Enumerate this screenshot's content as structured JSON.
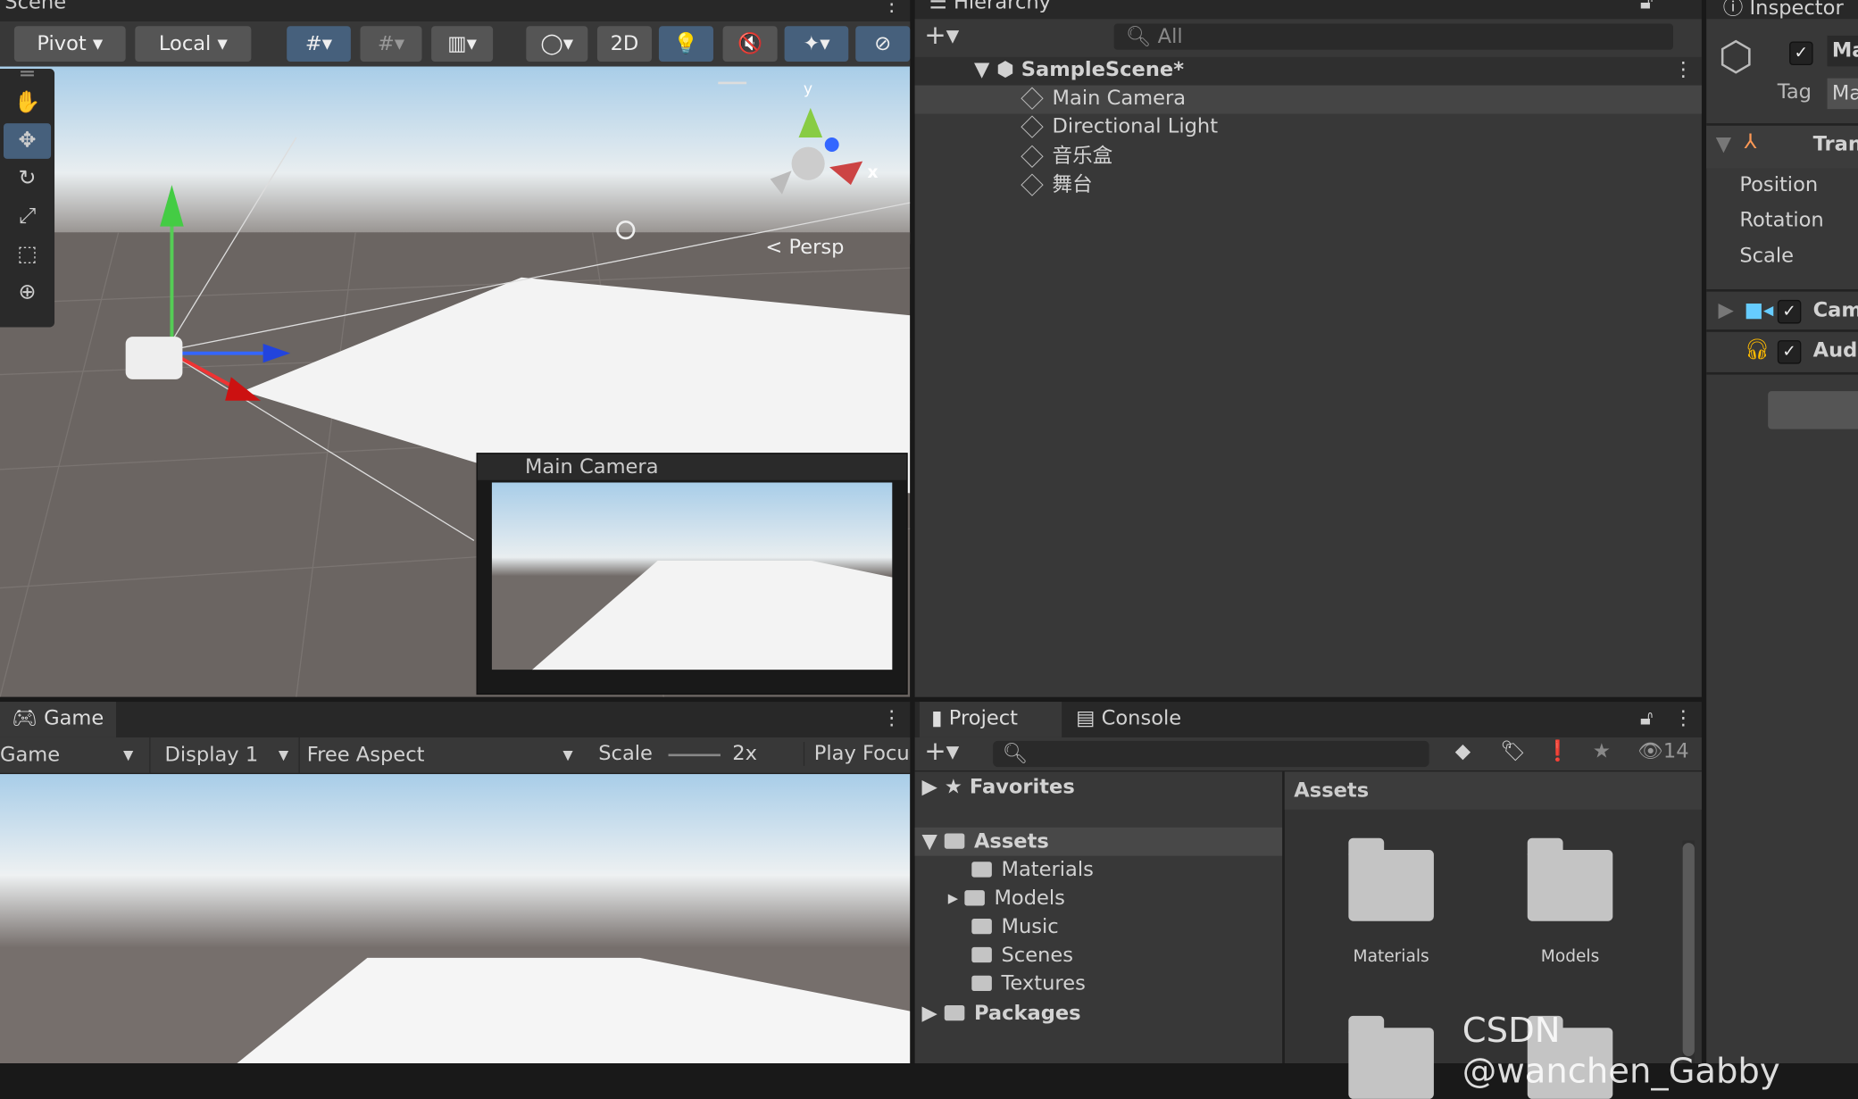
{
  "scene": {
    "tab": "Scene",
    "pivot": "Pivot",
    "local": "Local",
    "btn_2d": "2D",
    "persp": "Persp",
    "axis_x": "x",
    "axis_y": "y",
    "camera_preview_title": "Main Camera"
  },
  "hierarchy": {
    "tab": "Hierarchy",
    "search_placeholder": "All",
    "scene_name": "SampleScene*",
    "items": [
      "Main Camera",
      "Directional Light",
      "音乐盒",
      "舞台"
    ]
  },
  "inspector": {
    "tab": "Inspector",
    "name": "Ma",
    "tag_label": "Tag",
    "tag_value": "Ma",
    "transform": "Tran",
    "fields": [
      "Position",
      "Rotation",
      "Scale"
    ],
    "camera": "Cam",
    "audio": "Audi"
  },
  "game": {
    "tab": "Game",
    "mode": "Game",
    "display": "Display 1",
    "aspect": "Free Aspect",
    "scale_label": "Scale",
    "scale_value": "2x",
    "play_focus": "Play Focu"
  },
  "project": {
    "tab_project": "Project",
    "tab_console": "Console",
    "hidden_count": "14",
    "favorites": "Favorites",
    "assets": "Assets",
    "folders": [
      "Materials",
      "Models",
      "Music",
      "Scenes",
      "Textures"
    ],
    "packages": "Packages",
    "grid_title": "Assets",
    "grid_items": [
      "Materials",
      "Models"
    ]
  },
  "watermark": "CSDN @wanchen_Gabby"
}
